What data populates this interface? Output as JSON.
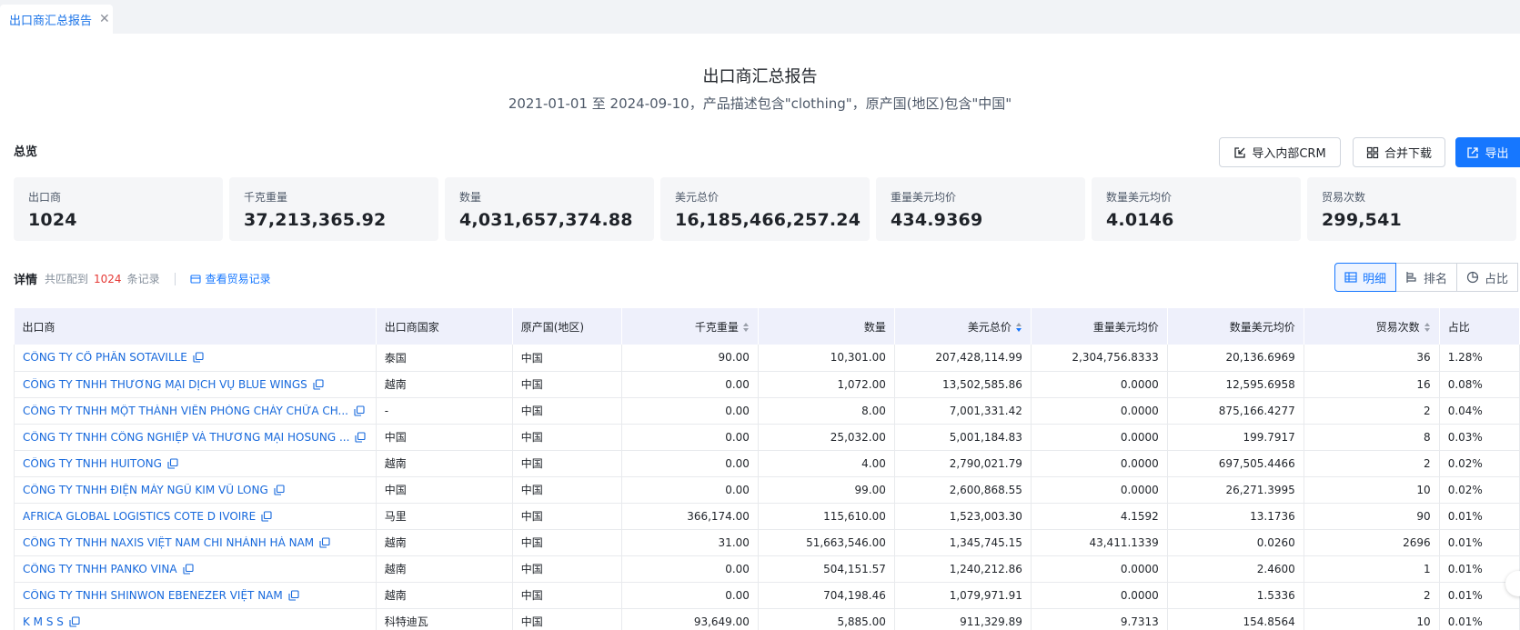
{
  "tab": {
    "label": "出口商汇总报告",
    "close": "✕"
  },
  "report": {
    "title": "出口商汇总报告",
    "subtitle": "2021-01-01 至 2024-09-10，产品描述包含\"clothing\"，原产国(地区)包含\"中国\""
  },
  "overview": {
    "label": "总览",
    "buttons": {
      "crm": "导入内部CRM",
      "merge": "合并下载",
      "export": "导出"
    },
    "stats": [
      {
        "label": "出口商",
        "value": "1024"
      },
      {
        "label": "千克重量",
        "value": "37,213,365.92"
      },
      {
        "label": "数量",
        "value": "4,031,657,374.88"
      },
      {
        "label": "美元总价",
        "value": "16,185,466,257.24"
      },
      {
        "label": "重量美元均价",
        "value": "434.9369"
      },
      {
        "label": "数量美元均价",
        "value": "4.0146"
      },
      {
        "label": "贸易次数",
        "value": "299,541"
      }
    ]
  },
  "details": {
    "label": "详情",
    "count_pre": "共匹配到",
    "count": "1024",
    "count_post": "条记录",
    "trade_link": "查看贸易记录",
    "views": [
      "明细",
      "排名",
      "占比"
    ]
  },
  "table": {
    "columns": [
      "出口商",
      "出口商国家",
      "原产国(地区)",
      "千克重量",
      "数量",
      "美元总价",
      "重量美元均价",
      "数量美元均价",
      "贸易次数",
      "占比"
    ],
    "rows": [
      [
        "CÔNG TY CỔ PHẦN SOTAVILLE",
        "泰国",
        "中国",
        "90.00",
        "10,301.00",
        "207,428,114.99",
        "2,304,756.8333",
        "20,136.6969",
        "36",
        "1.28%"
      ],
      [
        "CÔNG TY TNHH THƯƠNG MẠI DỊCH VỤ BLUE WINGS",
        "越南",
        "中国",
        "0.00",
        "1,072.00",
        "13,502,585.86",
        "0.0000",
        "12,595.6958",
        "16",
        "0.08%"
      ],
      [
        "CÔNG TY TNHH MỘT THÀNH VIÊN PHÒNG CHÁY CHỮA CH...",
        "-",
        "中国",
        "0.00",
        "8.00",
        "7,001,331.42",
        "0.0000",
        "875,166.4277",
        "2",
        "0.04%"
      ],
      [
        "CÔNG TY TNHH CÔNG NGHIỆP VÀ THƯƠNG MẠI HOSUNG ...",
        "中国",
        "中国",
        "0.00",
        "25,032.00",
        "5,001,184.83",
        "0.0000",
        "199.7917",
        "8",
        "0.03%"
      ],
      [
        "CÔNG TY TNHH HUITONG",
        "越南",
        "中国",
        "0.00",
        "4.00",
        "2,790,021.79",
        "0.0000",
        "697,505.4466",
        "2",
        "0.02%"
      ],
      [
        "CÔNG TY TNHH ĐIỆN MÁY NGŨ KIM VŨ LONG",
        "中国",
        "中国",
        "0.00",
        "99.00",
        "2,600,868.55",
        "0.0000",
        "26,271.3995",
        "10",
        "0.02%"
      ],
      [
        "AFRICA GLOBAL LOGISTICS COTE D IVOIRE",
        "马里",
        "中国",
        "366,174.00",
        "115,610.00",
        "1,523,003.30",
        "4.1592",
        "13.1736",
        "90",
        "0.01%"
      ],
      [
        "CÔNG TY TNHH NAXIS VIỆT NAM CHI NHÁNH HÀ NAM",
        "越南",
        "中国",
        "31.00",
        "51,663,546.00",
        "1,345,745.15",
        "43,411.1339",
        "0.0260",
        "2696",
        "0.01%"
      ],
      [
        "CÔNG TY TNHH PANKO VINA",
        "越南",
        "中国",
        "0.00",
        "504,151.57",
        "1,240,212.86",
        "0.0000",
        "2.4600",
        "1",
        "0.01%"
      ],
      [
        "CÔNG TY TNHH SHINWON EBENEZER VIỆT NAM",
        "越南",
        "中国",
        "0.00",
        "704,198.46",
        "1,079,971.91",
        "0.0000",
        "1.5336",
        "2",
        "0.01%"
      ],
      [
        "K M S S",
        "科特迪瓦",
        "中国",
        "93,649.00",
        "5,885.00",
        "911,329.89",
        "9.7313",
        "154.8564",
        "10",
        "0.01%"
      ]
    ]
  },
  "colors": {
    "accent": "#1677ff",
    "link": "#1668dc",
    "count": "#e53935",
    "header_bg": "#eef0fb"
  }
}
